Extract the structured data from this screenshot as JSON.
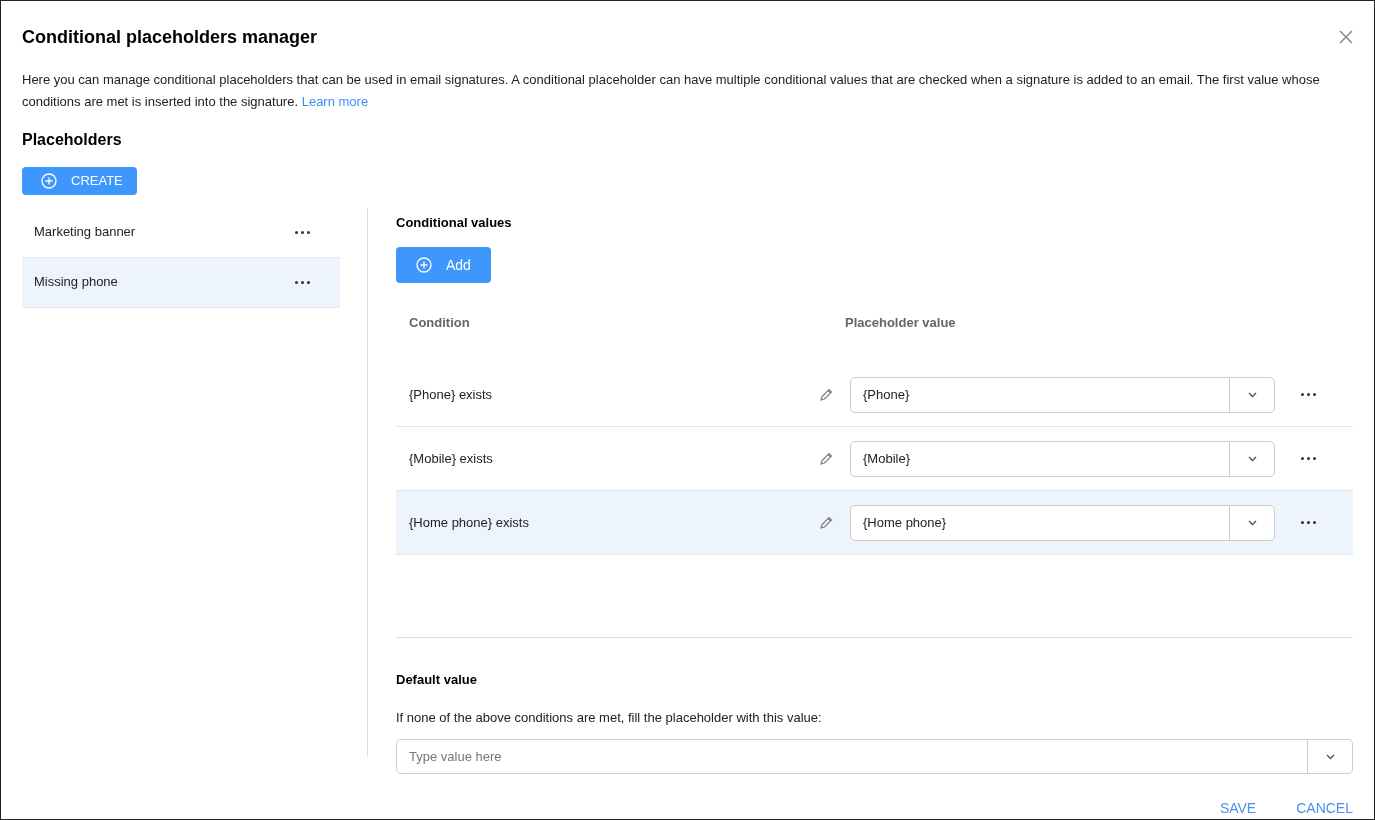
{
  "dialog": {
    "title": "Conditional placeholders manager",
    "description": "Here you can manage conditional placeholders that can be used in email signatures. A conditional placeholder can have multiple conditional values that are checked when a signature is added to an email. The first value whose conditions are met is inserted into the signature.",
    "learn_more": "Learn more"
  },
  "placeholders": {
    "heading": "Placeholders",
    "create_button": "CREATE",
    "items": [
      {
        "name": "Marketing banner",
        "selected": false
      },
      {
        "name": "Missing phone",
        "selected": true
      }
    ]
  },
  "conditional_values": {
    "heading": "Conditional values",
    "add_button": "Add",
    "columns": [
      "Condition",
      "Placeholder value"
    ],
    "rows": [
      {
        "condition": "{Phone} exists",
        "value": "{Phone}",
        "selected": false
      },
      {
        "condition": "{Mobile} exists",
        "value": "{Mobile}",
        "selected": false
      },
      {
        "condition": "{Home phone} exists",
        "value": "{Home phone}",
        "selected": true
      }
    ]
  },
  "default_value": {
    "heading": "Default value",
    "hint": "If none of the above conditions are met, fill the placeholder with this value:",
    "placeholder": "Type value here"
  },
  "buttons": [
    "SAVE",
    "CANCEL"
  ]
}
